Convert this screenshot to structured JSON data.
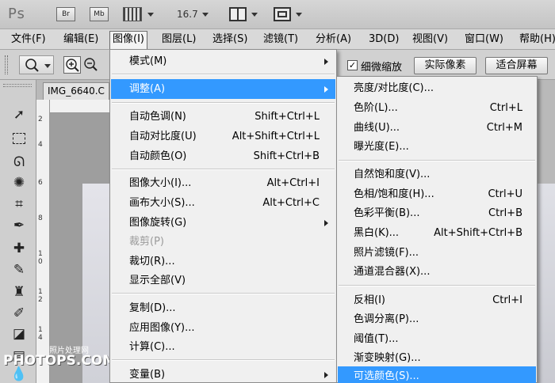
{
  "app": {
    "logo": "Ps",
    "btn_br": "Br",
    "btn_mb": "Mb",
    "zoom": "16.7"
  },
  "menubar": {
    "items": [
      "文件(F)",
      "编辑(E)",
      "图像(I)",
      "图层(L)",
      "选择(S)",
      "滤镜(T)",
      "分析(A)",
      "3D(D)",
      "视图(V)",
      "窗口(W)",
      "帮助(H)"
    ]
  },
  "options": {
    "scrubby_zoom_label": "细微缩放",
    "scrubby_zoom_checked": "✓",
    "actual_pixels": "实际像素",
    "fit_screen": "适合屏幕"
  },
  "document": {
    "tab_title": "IMG_6640.C"
  },
  "ruler": {
    "ticks": [
      "2",
      "4",
      "6",
      "8",
      "1",
      "0",
      "1",
      "2",
      "1",
      "4"
    ]
  },
  "watermark": {
    "line1": "照片处理网",
    "line2": "PHOTOPS.COM"
  },
  "image_menu": {
    "items": [
      {
        "label": "模式(M)",
        "shortcut": "",
        "submenu": true
      },
      {
        "label": "调整(A)",
        "shortcut": "",
        "submenu": true,
        "highlighted": true
      },
      {
        "label": "自动色调(N)",
        "shortcut": "Shift+Ctrl+L"
      },
      {
        "label": "自动对比度(U)",
        "shortcut": "Alt+Shift+Ctrl+L"
      },
      {
        "label": "自动颜色(O)",
        "shortcut": "Shift+Ctrl+B"
      },
      {
        "label": "图像大小(I)...",
        "shortcut": "Alt+Ctrl+I"
      },
      {
        "label": "画布大小(S)...",
        "shortcut": "Alt+Ctrl+C"
      },
      {
        "label": "图像旋转(G)",
        "shortcut": "",
        "submenu": true
      },
      {
        "label": "裁剪(P)",
        "shortcut": "",
        "disabled": true
      },
      {
        "label": "裁切(R)...",
        "shortcut": ""
      },
      {
        "label": "显示全部(V)",
        "shortcut": ""
      },
      {
        "label": "复制(D)...",
        "shortcut": ""
      },
      {
        "label": "应用图像(Y)...",
        "shortcut": ""
      },
      {
        "label": "计算(C)...",
        "shortcut": ""
      },
      {
        "label": "变量(B)",
        "shortcut": "",
        "submenu": true
      }
    ]
  },
  "adjust_menu": {
    "items": [
      {
        "label": "亮度/对比度(C)...",
        "shortcut": ""
      },
      {
        "label": "色阶(L)...",
        "shortcut": "Ctrl+L"
      },
      {
        "label": "曲线(U)...",
        "shortcut": "Ctrl+M"
      },
      {
        "label": "曝光度(E)...",
        "shortcut": ""
      },
      {
        "label": "自然饱和度(V)...",
        "shortcut": ""
      },
      {
        "label": "色相/饱和度(H)...",
        "shortcut": "Ctrl+U"
      },
      {
        "label": "色彩平衡(B)...",
        "shortcut": "Ctrl+B"
      },
      {
        "label": "黑白(K)...",
        "shortcut": "Alt+Shift+Ctrl+B"
      },
      {
        "label": "照片滤镜(F)...",
        "shortcut": ""
      },
      {
        "label": "通道混合器(X)...",
        "shortcut": ""
      },
      {
        "label": "反相(I)",
        "shortcut": "Ctrl+I"
      },
      {
        "label": "色调分离(P)...",
        "shortcut": ""
      },
      {
        "label": "阈值(T)...",
        "shortcut": ""
      },
      {
        "label": "渐变映射(G)...",
        "shortcut": ""
      },
      {
        "label": "可选颜色(S)...",
        "shortcut": "",
        "highlighted": true
      }
    ]
  },
  "colors": {
    "highlight": "#3399ff",
    "menu_bg": "#f0f0f0"
  }
}
